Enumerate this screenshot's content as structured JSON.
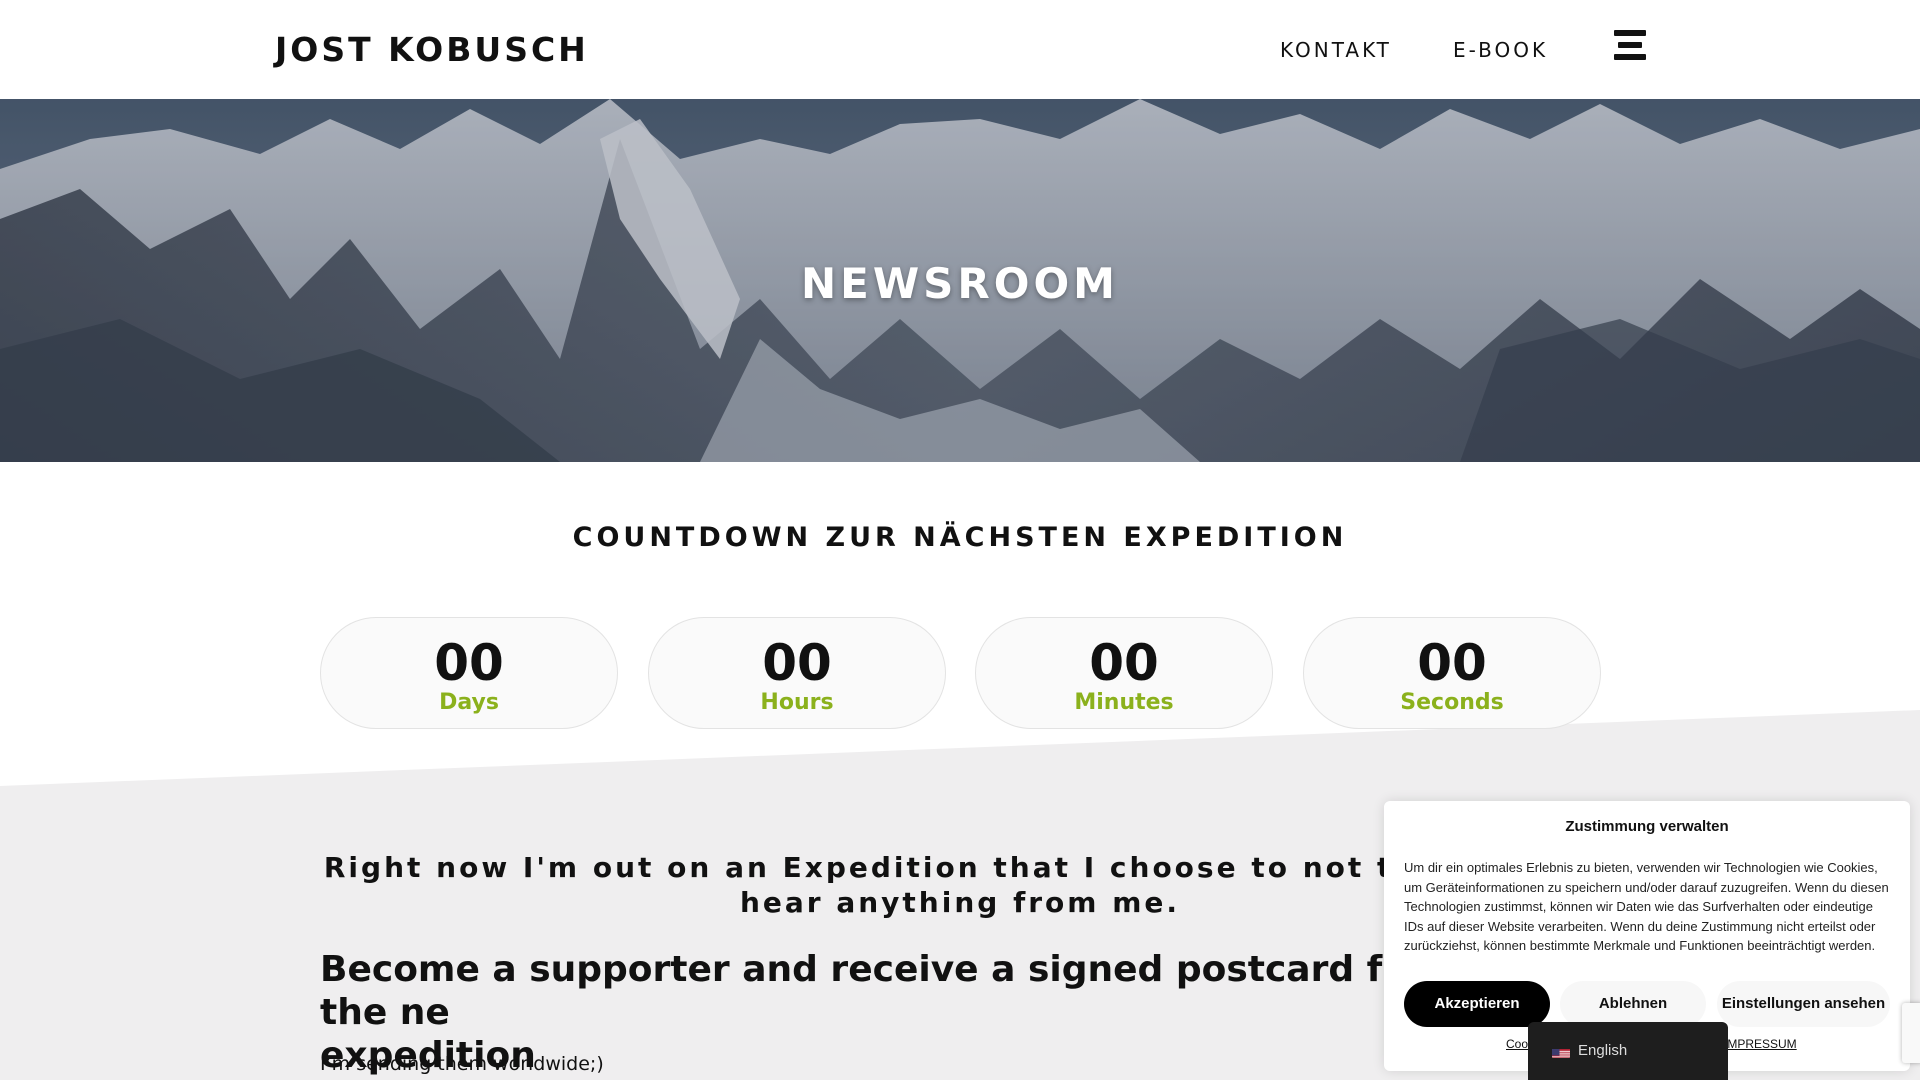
{
  "header": {
    "logo": "JOST KOBUSCH",
    "nav": [
      {
        "label": "KONTAKT"
      },
      {
        "label": "E-BOOK"
      }
    ],
    "menu_icon": "hamburger-menu-icon"
  },
  "hero": {
    "title": "NEWSROOM"
  },
  "countdown": {
    "title": "COUNTDOWN ZUR NÄCHSTEN EXPEDITION",
    "units": [
      {
        "value": "00",
        "label": "Days"
      },
      {
        "value": "00",
        "label": "Hours"
      },
      {
        "value": "00",
        "label": "Minutes"
      },
      {
        "value": "00",
        "label": "Seconds"
      }
    ]
  },
  "content": {
    "statement_line1": "Right now I'm out on an Expedition that I choose to not talk about -",
    "statement_line2": "hear anything from me.",
    "supporter_line1": "Become a supporter and receive a signed postcard from the ne",
    "supporter_line2": "expedition",
    "worldwide": "I’m sending them worldwide;)"
  },
  "consent": {
    "title": "Zustimmung verwalten",
    "text": "Um dir ein optimales Erlebnis zu bieten, verwenden wir Technologien wie Cookies, um Geräteinformationen zu speichern und/oder darauf zuzugreifen. Wenn du diesen Technologien zustimmst, können wir Daten wie das Surfverhalten oder eindeutige IDs auf dieser Website verarbeiten. Wenn du deine Zustimmung nicht erteilst oder zurückziehst, können bestimmte Merkmale und Funktionen beeinträchtigt werden.",
    "accept": "Akzeptieren",
    "decline": "Ablehnen",
    "settings": "Einstellungen ansehen",
    "cookie_link": "Coo",
    "impressum_link": "IMPRESSUM"
  },
  "language_switcher": {
    "label": "English",
    "flag_icon": "us-flag-icon"
  },
  "colors": {
    "accent_green": "#8bb11c",
    "grey_band": "#efeeef",
    "text": "#111111"
  }
}
